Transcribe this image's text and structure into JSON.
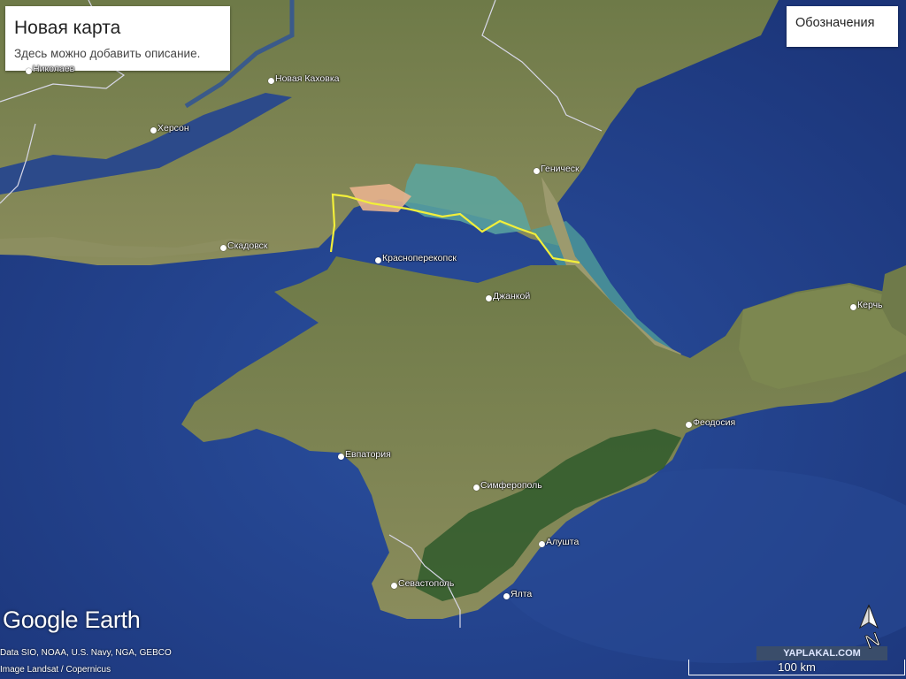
{
  "map_info": {
    "title": "Новая карта",
    "description": "Здесь можно добавить описание."
  },
  "legend_button": {
    "label": "Обозначения"
  },
  "places": [
    {
      "name": "Николаев",
      "type": "city"
    },
    {
      "name": "Новая Каховка",
      "type": "city"
    },
    {
      "name": "Херсон",
      "type": "city"
    },
    {
      "name": "Геническ",
      "type": "city"
    },
    {
      "name": "Скадовск",
      "type": "city"
    },
    {
      "name": "Красноперекопск",
      "type": "city"
    },
    {
      "name": "Джанкой",
      "type": "city"
    },
    {
      "name": "Керчь",
      "type": "city"
    },
    {
      "name": "Феодосия",
      "type": "city"
    },
    {
      "name": "Евпатория",
      "type": "city"
    },
    {
      "name": "Симферополь",
      "type": "city"
    },
    {
      "name": "Алушта",
      "type": "city"
    },
    {
      "name": "Севастополь",
      "type": "city"
    },
    {
      "name": "Ялта",
      "type": "city"
    }
  ],
  "branding": {
    "logo_text": "Google Earth",
    "attribution_1": "Data SIO, NOAA, U.S. Navy, NGA, GEBCO",
    "attribution_2": "Image Landsat / Copernicus",
    "watermark": "YAPLAKAL.COM"
  },
  "scale_bar": {
    "label": "100 km"
  },
  "compass": {
    "label": "N",
    "icon": "north-arrow-icon"
  },
  "colors": {
    "sea_deep": "#1d3a80",
    "sea_shallow": "#2e6fa0",
    "land": "#7f8750",
    "mountains": "#2f5a2c",
    "route_line": "#f2ef3a",
    "border_line": "#d8d8e8"
  }
}
